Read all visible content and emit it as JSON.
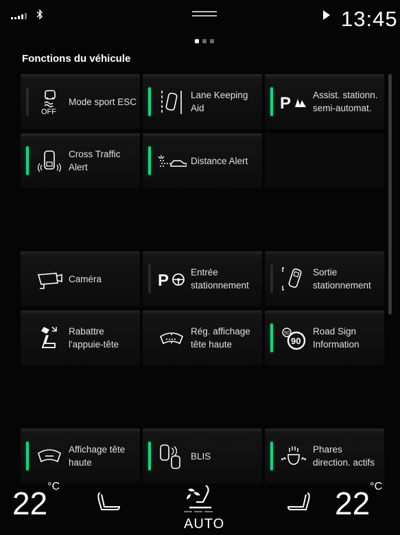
{
  "status": {
    "time": "13:45"
  },
  "page": {
    "title": "Fonctions du véhicule",
    "page_indicator": {
      "count": 3,
      "active": 0
    }
  },
  "tiles": [
    {
      "label": "Mode sport ESC",
      "icon": "esc-off-icon",
      "indicator": "off"
    },
    {
      "label": "Lane Keeping Aid",
      "icon": "lane-keeping-icon",
      "indicator": "on"
    },
    {
      "label": "Assist. stationn. semi-automat.",
      "icon": "park-assist-icon",
      "indicator": "on"
    },
    {
      "label": "Cross Traffic Alert",
      "icon": "cross-traffic-icon",
      "indicator": "on"
    },
    {
      "label": "Distance Alert",
      "icon": "distance-alert-icon",
      "indicator": "on"
    },
    {
      "label": "Caméra",
      "icon": "camera-icon",
      "indicator": "none"
    },
    {
      "label": "Entrée stationnement",
      "icon": "park-in-icon",
      "indicator": "off"
    },
    {
      "label": "Sortie stationnement",
      "icon": "park-out-icon",
      "indicator": "off"
    },
    {
      "label": "Rabattre l'appuie-tête",
      "icon": "headrest-fold-icon",
      "indicator": "none"
    },
    {
      "label": "Rég. affichage tête haute",
      "icon": "hud-adjust-icon",
      "indicator": "none"
    },
    {
      "label": "Road Sign Information",
      "icon": "road-sign-icon",
      "indicator": "on"
    },
    {
      "label": "Affichage tête haute",
      "icon": "hud-icon",
      "indicator": "on"
    },
    {
      "label": "BLIS",
      "icon": "blis-icon",
      "indicator": "on"
    },
    {
      "label": "Phares direction. actifs",
      "icon": "headlight-icon",
      "indicator": "on"
    }
  ],
  "climate": {
    "left_temp": "22",
    "right_temp": "22",
    "unit": "°C",
    "mode": "AUTO"
  },
  "colors": {
    "indicator_on": "#1fd07a",
    "indicator_off": "#2a2a2a",
    "background": "#050505"
  }
}
